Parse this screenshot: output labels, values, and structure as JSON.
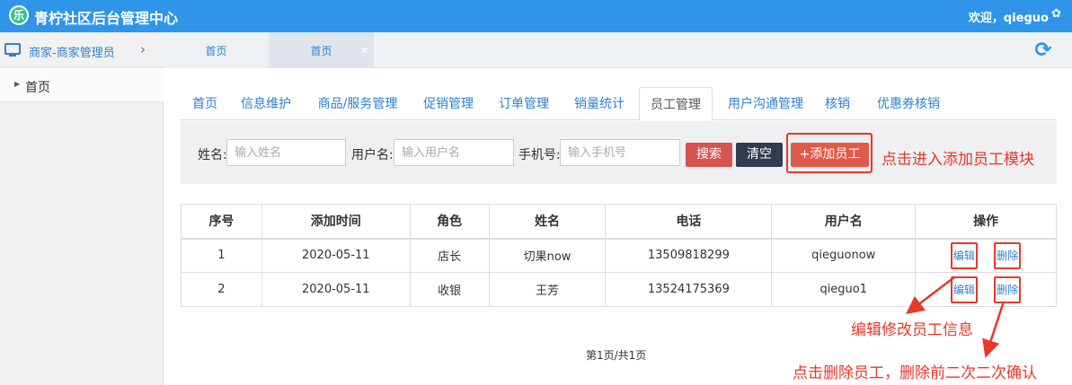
{
  "app": {
    "logo_char": "乐",
    "title": "青柠社区后台管理中心",
    "welcome": "欢迎，qieguo"
  },
  "sidebar": {
    "header_label": "商家-商家管理员",
    "items": [
      {
        "label": "首页"
      }
    ]
  },
  "page_tabs": [
    {
      "label": "首页"
    },
    {
      "label": "首页"
    }
  ],
  "module_tabs": [
    {
      "label": "首页"
    },
    {
      "label": "信息维护"
    },
    {
      "label": "商品/服务管理"
    },
    {
      "label": "促销管理"
    },
    {
      "label": "订单管理"
    },
    {
      "label": "销量统计"
    },
    {
      "label": "员工管理",
      "active": true
    },
    {
      "label": "用户沟通管理"
    },
    {
      "label": "核销"
    },
    {
      "label": "优惠券核销"
    }
  ],
  "search": {
    "name_label": "姓名:",
    "name_placeholder": "输入姓名",
    "username_label": "用户名:",
    "username_placeholder": "输入用户名",
    "phone_label": "手机号:",
    "phone_placeholder": "输入手机号",
    "search_button": "搜索",
    "clear_button": "清空",
    "add_button": "+添加员工"
  },
  "annotations": {
    "add": "点击进入添加员工模块",
    "edit": "编辑修改员工信息",
    "delete": "点击删除员工，删除前二次二次确认"
  },
  "table": {
    "headers": [
      "序号",
      "添加时间",
      "角色",
      "姓名",
      "电话",
      "用户名",
      "操作"
    ],
    "rows": [
      {
        "no": "1",
        "date": "2020-05-11",
        "role": "店长",
        "name": "切果now",
        "phone": "13509818299",
        "username": "qieguonow",
        "edit": "编辑",
        "delete": "删除"
      },
      {
        "no": "2",
        "date": "2020-05-11",
        "role": "收银",
        "name": "王芳",
        "phone": "13524175369",
        "username": "qieguo1",
        "edit": "编辑",
        "delete": "删除"
      }
    ]
  },
  "pager": {
    "text": "第1页/共1页"
  },
  "colors": {
    "primary": "#2f95e8",
    "link": "#2f7fd1",
    "danger": "#d9534f",
    "dark": "#2e3e50",
    "annotation": "#e8382a"
  }
}
